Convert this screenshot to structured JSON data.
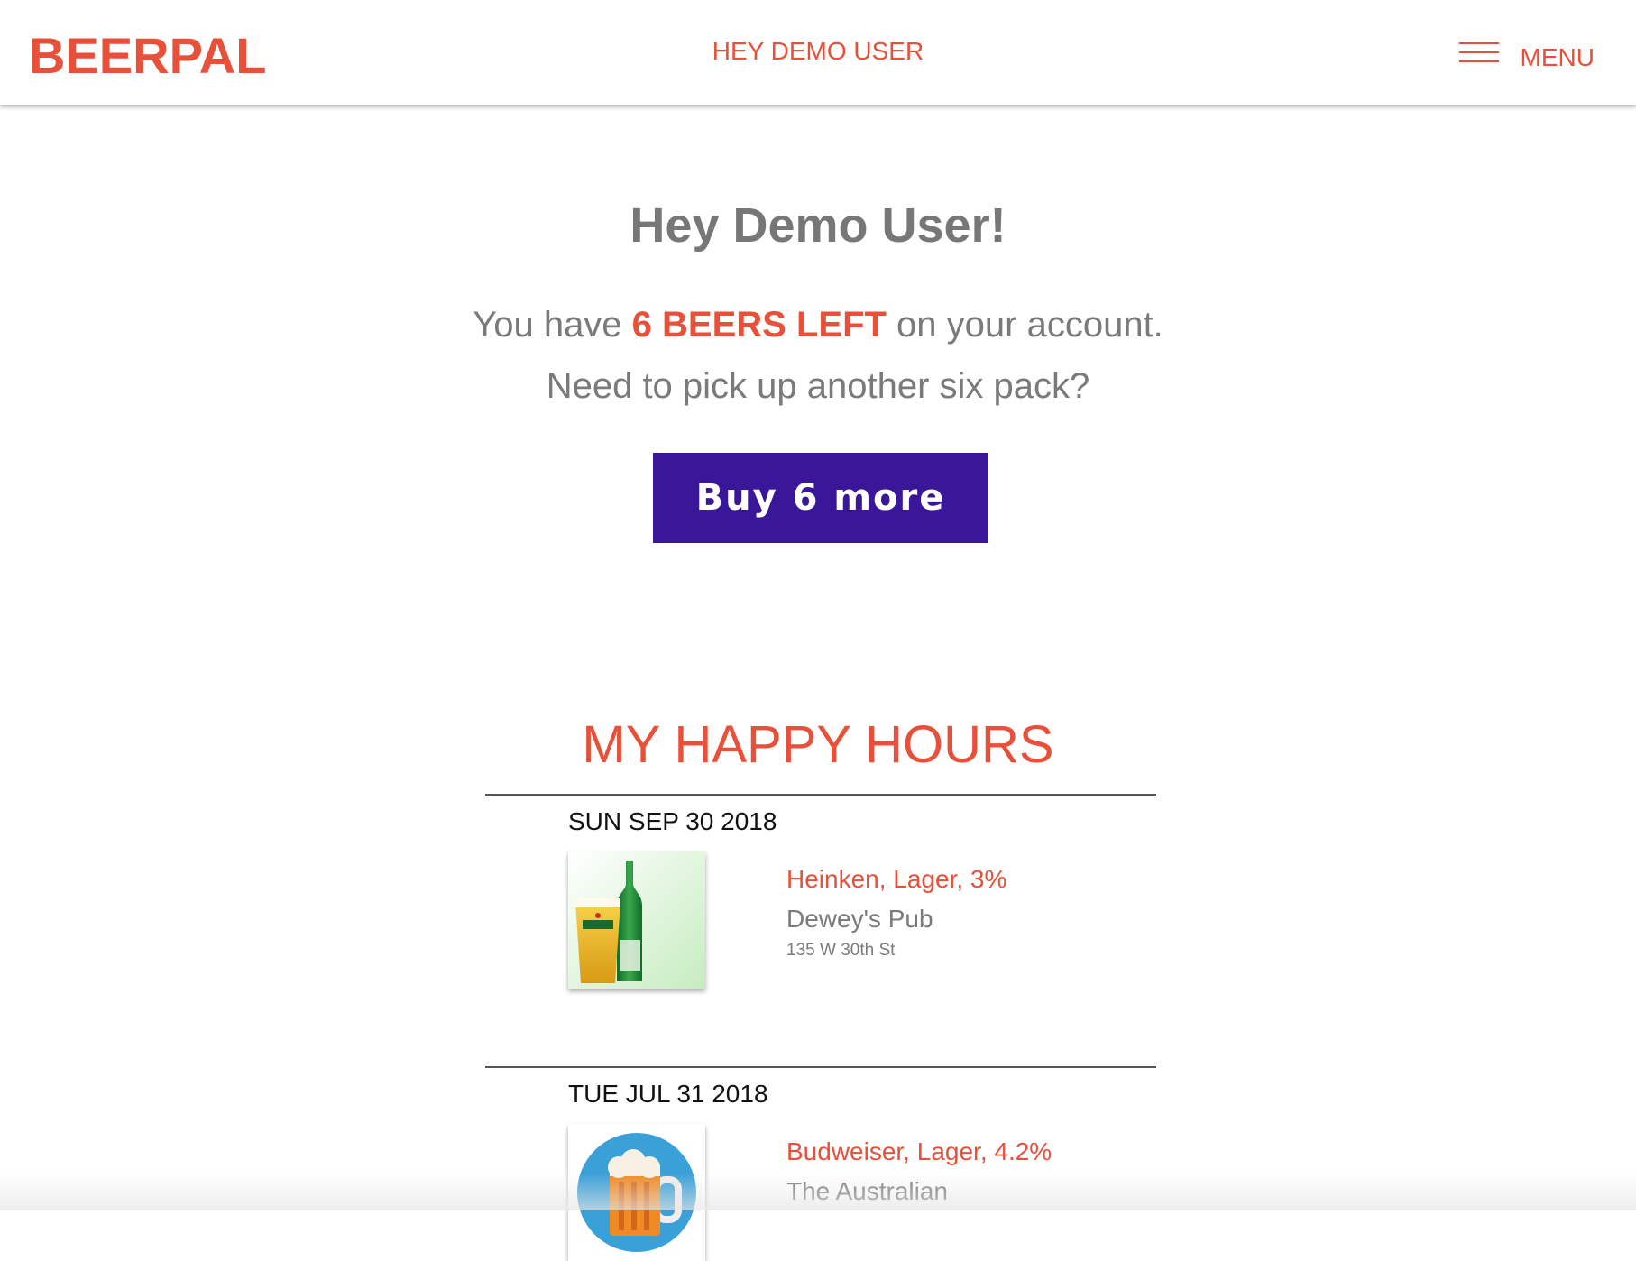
{
  "header": {
    "logo": "BEERPAL",
    "greeting": "HEY DEMO USER",
    "menu_label": "MENU"
  },
  "hero": {
    "title": "Hey Demo User!",
    "line1_prefix": "You have ",
    "beers_left": "6 BEERS LEFT",
    "line1_suffix": " on your account.",
    "line2": "Need to pick up another six pack?",
    "buy_button": "Buy 6 more"
  },
  "happy_hours": {
    "title": "MY HAPPY HOURS",
    "entries": [
      {
        "date": "SUN SEP 30 2018",
        "beer": "Heinken, Lager, 3%",
        "venue": "Dewey's Pub",
        "address": "135 W 30th St",
        "image_icon": "beer-bottle-and-glass"
      },
      {
        "date": "TUE JUL 31 2018",
        "beer": "Budweiser, Lager, 4.2%",
        "venue": "The Australian",
        "address": "",
        "image_icon": "beer-mug"
      }
    ]
  },
  "colors": {
    "brand": "#e8503a",
    "button": "#3a1799",
    "muted_text": "#7a7a7a"
  }
}
